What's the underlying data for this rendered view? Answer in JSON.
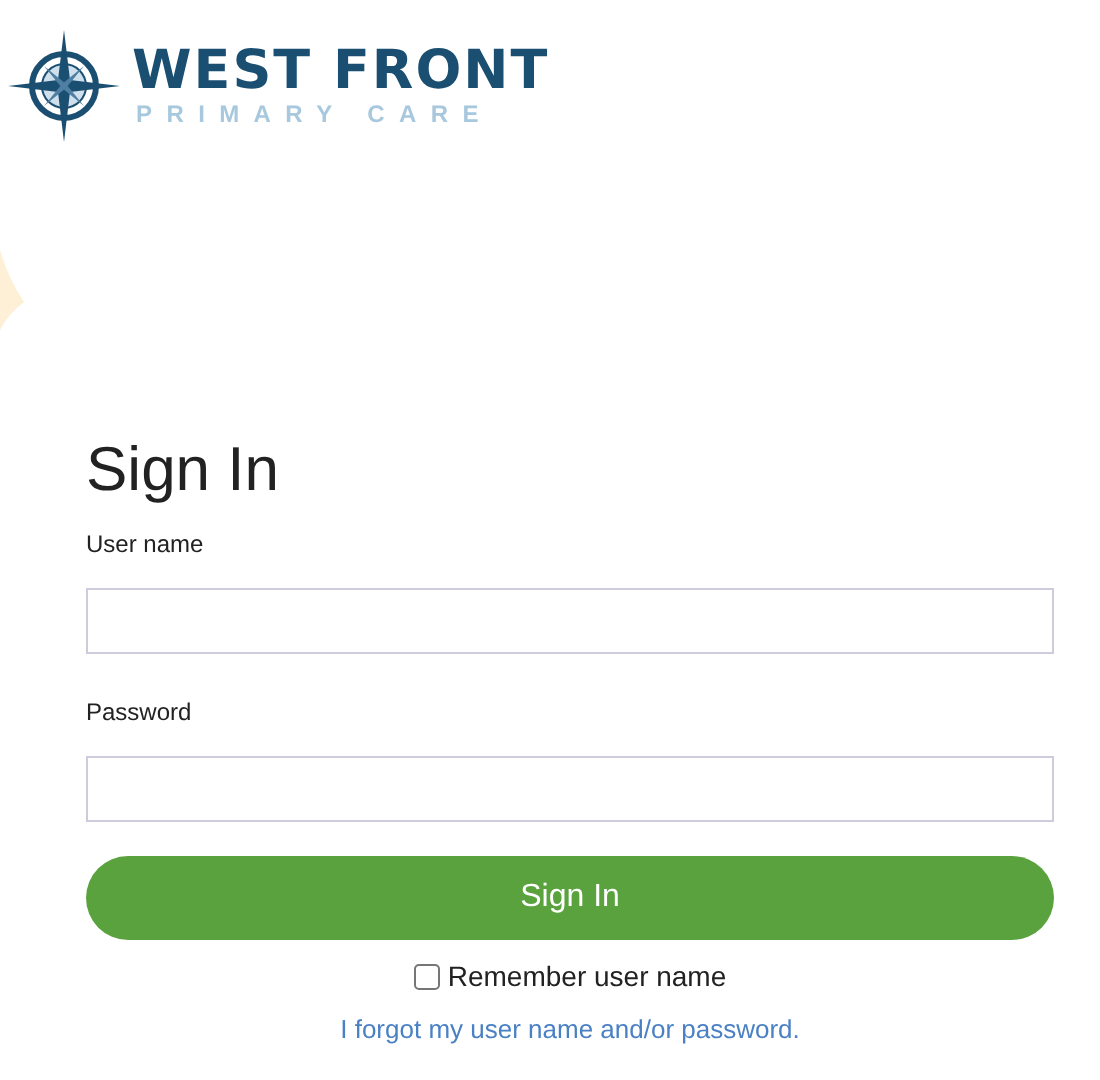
{
  "logo": {
    "title": "WEST FRONT",
    "subtitle": "PRIMARY CARE"
  },
  "form": {
    "heading": "Sign In",
    "fields": [
      {
        "label": "User name"
      },
      {
        "label": "Password"
      }
    ],
    "submit": "Sign In",
    "remember": {
      "label": "Remember user name",
      "checked": false
    },
    "forgot_link": "I forgot my user name and/or password."
  }
}
